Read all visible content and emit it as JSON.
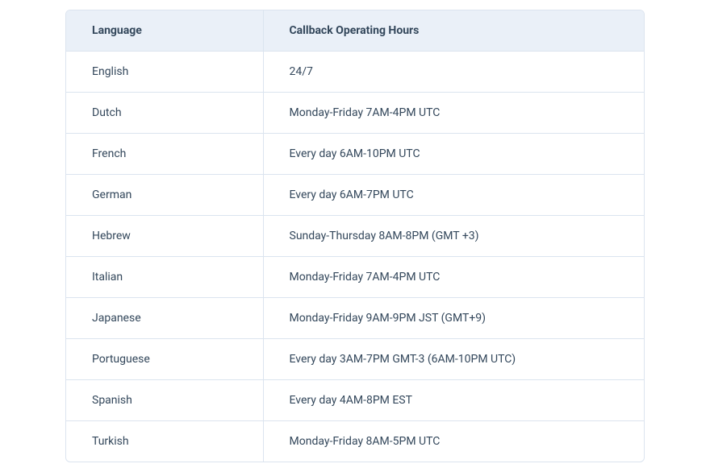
{
  "table": {
    "headers": [
      "Language",
      "Callback Operating Hours"
    ],
    "rows": [
      {
        "language": "English",
        "hours": "24/7"
      },
      {
        "language": "Dutch",
        "hours": "Monday-Friday 7AM-4PM UTC"
      },
      {
        "language": "French",
        "hours": "Every day 6AM-10PM UTC"
      },
      {
        "language": "German",
        "hours": "Every day 6AM-7PM UTC"
      },
      {
        "language": "Hebrew",
        "hours": "Sunday-Thursday 8AM-8PM (GMT +3)"
      },
      {
        "language": "Italian",
        "hours": "Monday-Friday 7AM-4PM UTC"
      },
      {
        "language": "Japanese",
        "hours": "Monday-Friday 9AM-9PM JST (GMT+9)"
      },
      {
        "language": "Portuguese",
        "hours": "Every day 3AM-7PM GMT-3 (6AM-10PM UTC)"
      },
      {
        "language": "Spanish",
        "hours": "Every day 4AM-8PM EST"
      },
      {
        "language": "Turkish",
        "hours": "Monday-Friday 8AM-5PM UTC"
      }
    ]
  }
}
